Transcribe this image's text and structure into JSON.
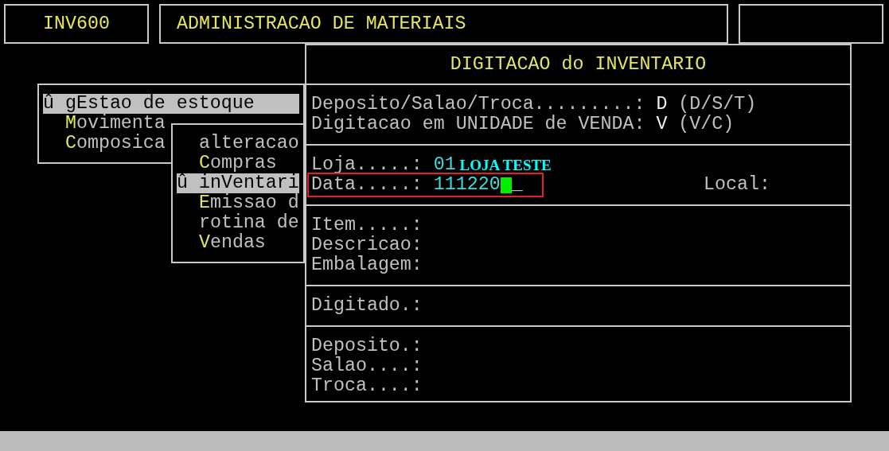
{
  "header": {
    "program_code": "INV600",
    "system_title": "ADMINISTRACAO DE MATERIAIS"
  },
  "menus": [
    {
      "items": [
        {
          "selected": true,
          "parts": [
            {
              "text": "û gEstao de estoque",
              "hot": false
            }
          ]
        },
        {
          "selected": false,
          "parts": [
            {
              "text": "M",
              "hot": true
            },
            {
              "text": "ovimenta",
              "hot": false
            }
          ]
        },
        {
          "selected": false,
          "parts": [
            {
              "text": "C",
              "hot": true
            },
            {
              "text": "omposica",
              "hot": false
            }
          ]
        }
      ]
    },
    {
      "items": [
        {
          "selected": false,
          "parts": [
            {
              "text": "alteracao",
              "hot": false
            }
          ]
        },
        {
          "selected": false,
          "parts": [
            {
              "text": "C",
              "hot": true
            },
            {
              "text": "ompras",
              "hot": false
            }
          ]
        },
        {
          "selected": true,
          "parts": [
            {
              "text": "û inVentari",
              "hot": false
            }
          ]
        },
        {
          "selected": false,
          "parts": [
            {
              "text": "E",
              "hot": true
            },
            {
              "text": "missao d",
              "hot": false
            }
          ]
        },
        {
          "selected": false,
          "parts": [
            {
              "text": "rotina de",
              "hot": false
            }
          ]
        },
        {
          "selected": false,
          "parts": [
            {
              "text": "V",
              "hot": true
            },
            {
              "text": "endas",
              "hot": false
            }
          ]
        }
      ]
    }
  ],
  "panel": {
    "title": "DIGITACAO do INVENTARIO",
    "sections": [
      {
        "fields": [
          {
            "kind": "choice",
            "label": "Deposito/Salao/Troca.........:",
            "value": "D",
            "hint": "(D/S/T)"
          },
          {
            "kind": "choice",
            "label": "Digitacao em UNIDADE de VENDA:",
            "value": "V",
            "hint": "(V/C)"
          }
        ]
      },
      {
        "fields": [
          {
            "kind": "entry",
            "label": "Loja.....:",
            "value": "01",
            "note": "LOJA TESTE"
          },
          {
            "kind": "entry",
            "label": "Data.....:",
            "value": "111220",
            "cursor": true,
            "fill": "_",
            "framed": true,
            "side_label": "Local:"
          }
        ]
      },
      {
        "fields": [
          {
            "kind": "plain",
            "label": "Item.....:"
          },
          {
            "kind": "plain",
            "label": "Descricao:"
          },
          {
            "kind": "plain",
            "label": "Embalagem:"
          }
        ]
      },
      {
        "fields": [
          {
            "kind": "plain",
            "label": "Digitado.:"
          }
        ]
      },
      {
        "fields": [
          {
            "kind": "plain",
            "label": "Deposito.:"
          },
          {
            "kind": "plain",
            "label": "Salao....:"
          },
          {
            "kind": "plain",
            "label": "Troca....:"
          }
        ]
      }
    ]
  }
}
